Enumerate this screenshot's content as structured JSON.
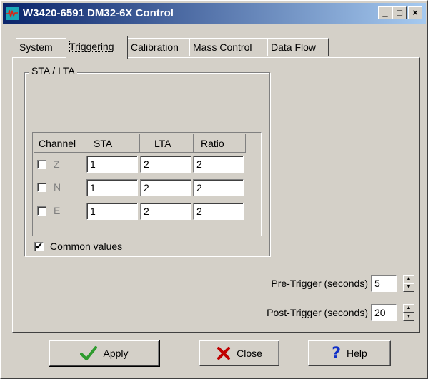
{
  "window": {
    "title": "W3420-6591 DM32-6X Control"
  },
  "title_buttons": {
    "minimize": "_",
    "maximize": "□",
    "close": "×"
  },
  "tabs": [
    {
      "label": "System"
    },
    {
      "label": "Triggering",
      "active": true
    },
    {
      "label": "Calibration"
    },
    {
      "label": "Mass Control"
    },
    {
      "label": "Data Flow"
    }
  ],
  "sta_lta": {
    "group_title": "STA / LTA",
    "columns": [
      "Channel",
      "STA",
      "LTA",
      "Ratio"
    ],
    "rows": [
      {
        "channel": "Z",
        "checked": false,
        "sta": "1",
        "lta": "2",
        "ratio": "2"
      },
      {
        "channel": "N",
        "checked": false,
        "sta": "1",
        "lta": "2",
        "ratio": "2"
      },
      {
        "channel": "E",
        "checked": false,
        "sta": "1",
        "lta": "2",
        "ratio": "2"
      }
    ],
    "common_values": {
      "label": "Common values",
      "checked": true
    }
  },
  "pre_trigger": {
    "label": "Pre-Trigger (seconds)",
    "value": "5"
  },
  "post_trigger": {
    "label": "Post-Trigger (seconds)",
    "value": "20"
  },
  "buttons": {
    "apply": {
      "label": "Apply",
      "icon": "checkmark-icon",
      "color": "#2e9b2e"
    },
    "close": {
      "label": "Close",
      "icon": "x-icon",
      "color": "#c00000"
    },
    "help": {
      "label": "Help",
      "icon": "question-icon",
      "color": "#1030c8"
    }
  }
}
